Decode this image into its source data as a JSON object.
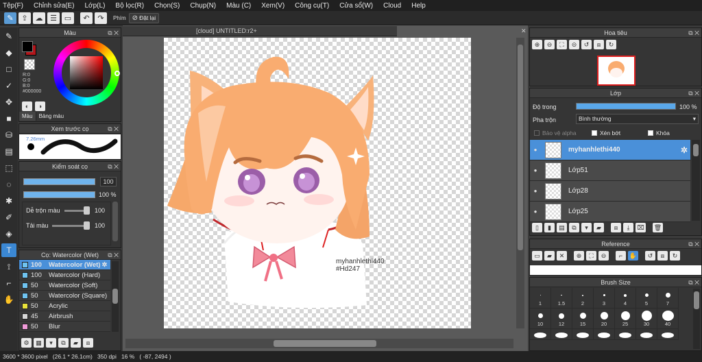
{
  "menu": [
    "Tệp(F)",
    "Chỉnh sửa(E)",
    "Lớp(L)",
    "Bộ lọc(R)",
    "Chọn(S)",
    "Chụp(N)",
    "Màu (C)",
    "Xem(V)",
    "Công cụ(T)",
    "Cửa sổ(W)",
    "Cloud",
    "Help"
  ],
  "toolbar": {
    "keys_label": "Phím",
    "reset_label": "Đặt lại"
  },
  "colors": {
    "fg": "#b3161b",
    "bg": "#ffffff",
    "accent": "#4a90d9"
  },
  "color_panel": {
    "title": "Màu",
    "r": "R:0",
    "g": "G:0",
    "b": "B:0",
    "hex": "#000000",
    "tab_color": "Màu",
    "tab_palette": "Bảng màu"
  },
  "brush_preview": {
    "title": "Xem trước cọ",
    "size": "7.26mm"
  },
  "brush_control": {
    "title": "Kiểm soát cọ",
    "size_value": "100",
    "opacity_value": "100 %",
    "blend_label": "Dễ trộn màu",
    "blend_value": "100",
    "paint_label": "Tải màu",
    "paint_value": "100"
  },
  "brush_list": {
    "title": "Cọ: Watercolor (Wet)",
    "items": [
      {
        "size": "100",
        "name": "Watercolor (Wet)",
        "color": "#6fc3f0"
      },
      {
        "size": "100",
        "name": "Watercolor (Hard)",
        "color": "#6fc3f0"
      },
      {
        "size": "50",
        "name": "Watercolor (Soft)",
        "color": "#6fc3f0"
      },
      {
        "size": "50",
        "name": "Watercolor (Square)",
        "color": "#6fc3f0"
      },
      {
        "size": "50",
        "name": "Acrylic",
        "color": "#e8e23a"
      },
      {
        "size": "45",
        "name": "Airbrush",
        "color": "#d8d8d8"
      },
      {
        "size": "50",
        "name": "Blur",
        "color": "#f09ad8"
      }
    ]
  },
  "canvas": {
    "tab": "[cloud] UNTITLED:r2+",
    "signature": "myhanhlethi440\n#Hd247"
  },
  "status": "3600 * 3600 pixel   (26.1 * 26.1cm)   350 dpi   16 %   ( -87, 2494 )",
  "navigator": {
    "title": "Hoa tiêu"
  },
  "layers": {
    "title": "Lớp",
    "opacity_label": "Độ trong",
    "opacity_value": "100 %",
    "opacity": 1.0,
    "blend_label": "Pha trộn",
    "blend_value": "Bình thường",
    "protect_alpha": "Bảo vệ alpha",
    "clipping": "Xén bớt",
    "lock": "Khóa",
    "items": [
      {
        "name": "myhanhlethi440",
        "selected": true
      },
      {
        "name": "Lớp51",
        "selected": false
      },
      {
        "name": "Lớp28",
        "selected": false
      },
      {
        "name": "Lớp25",
        "selected": false
      }
    ]
  },
  "reference": {
    "title": "Reference"
  },
  "brush_size": {
    "title": "Brush Size",
    "row1": [
      "1",
      "1.5",
      "2",
      "3",
      "4",
      "5",
      "7"
    ],
    "row2": [
      "10",
      "12",
      "15",
      "20",
      "25",
      "30",
      "40"
    ]
  }
}
